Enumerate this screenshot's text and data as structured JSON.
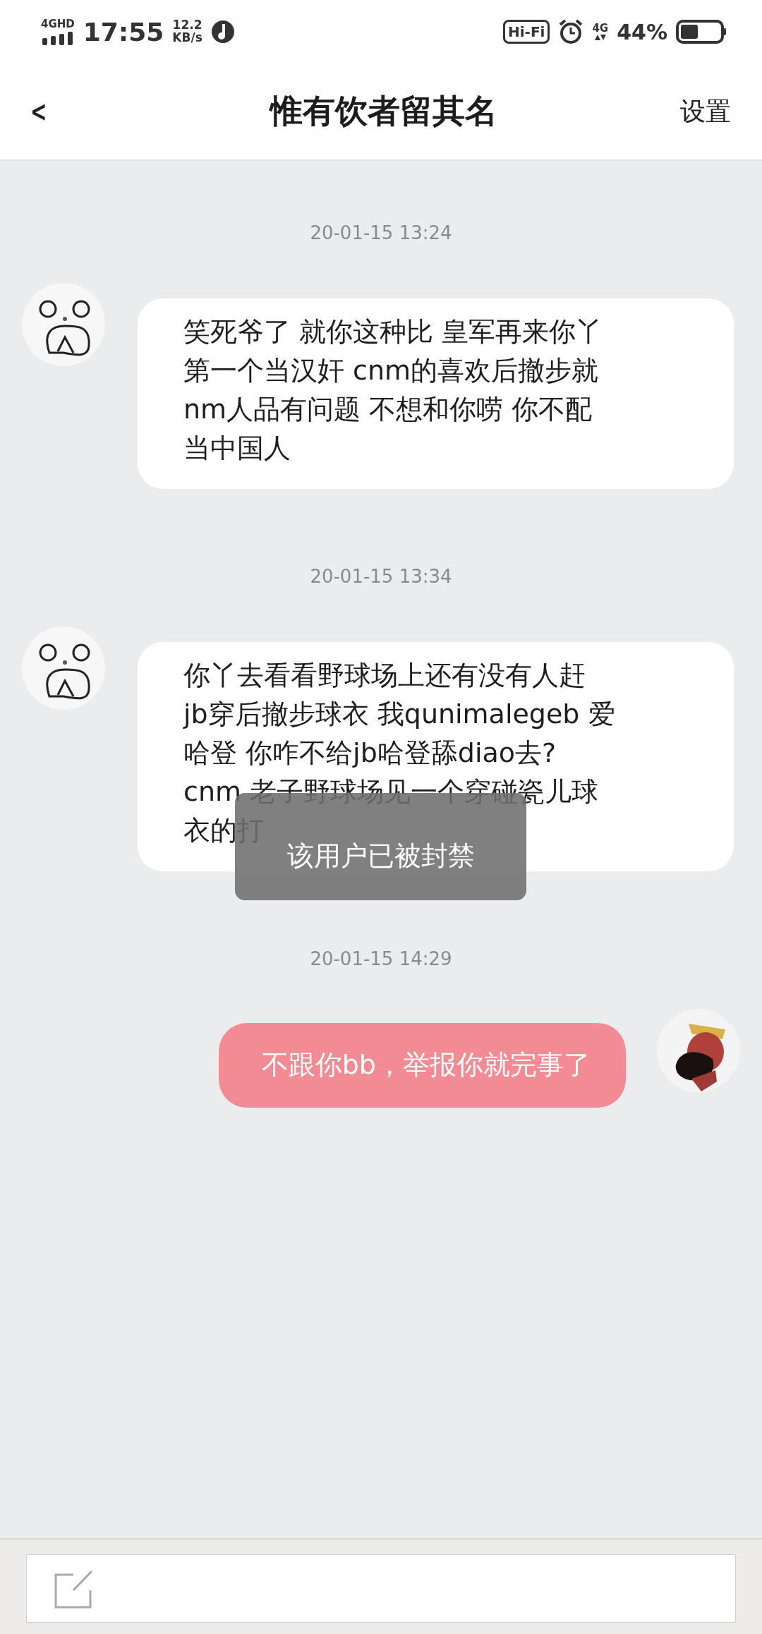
{
  "status_bar": {
    "network_label": "4GHD",
    "time": "17:55",
    "speed": "12.2",
    "speed_unit": "KB/s",
    "hifi": "Hi-Fi",
    "data_label": "4G",
    "battery": "44%"
  },
  "header": {
    "back": "<",
    "title": "惟有饮者留其名",
    "action": "设置"
  },
  "conversation": [
    {
      "timestamp": "20-01-15 13:24",
      "messages": [
        {
          "kind": "incoming",
          "lines": [
            "笑死爷了 就你这种比 皇军再来你丫",
            "第一个当汉奸 cnm的喜欢后撤步就",
            "nm人品有问题 不想和你唠 你不配",
            "当中国人"
          ]
        }
      ]
    },
    {
      "timestamp": "20-01-15 13:34",
      "messages": [
        {
          "kind": "incoming",
          "lines": [
            "你丫去看看野球场上还有没有人赶",
            "jb穿后撤步球衣 我qunimalegeb 爱",
            "哈登 你咋不给jb哈登舔diao去?",
            "cnm 老子野球场见一个穿碰瓷儿球",
            "衣的打"
          ]
        }
      ]
    },
    {
      "timestamp": "20-01-15 14:29",
      "messages": [
        {
          "kind": "outgoing",
          "lines": [
            "不跟你bb，举报你就完事了"
          ]
        }
      ]
    }
  ],
  "toast": {
    "text": "该用户已被封禁"
  }
}
